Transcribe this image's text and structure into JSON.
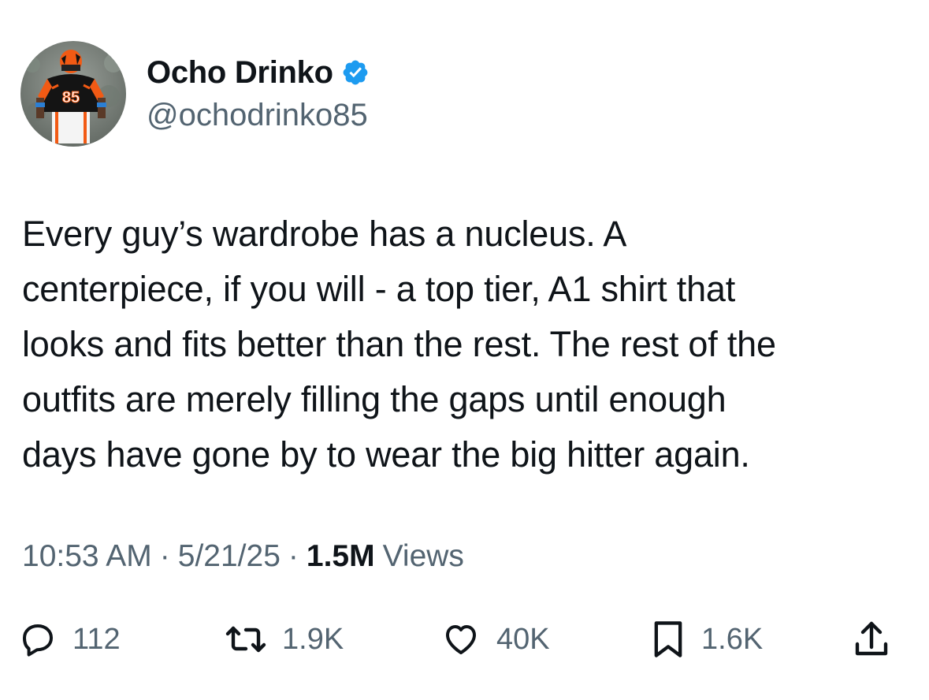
{
  "author": {
    "display_name": "Ocho Drinko",
    "handle": "@ochodrinko85",
    "verified_icon": "verified-badge-icon",
    "avatar_jersey_number": "85"
  },
  "tweet": {
    "text": "Every guy’s wardrobe has a nucleus. A\ncenterpiece, if you will - a top tier, A1 shirt that\nlooks and fits better than the rest. The rest of the\noutfits are merely filling the gaps until enough\ndays have gone by to wear the big hitter again."
  },
  "meta": {
    "time": "10:53 AM",
    "separator": "·",
    "date": "5/21/25",
    "views_count": "1.5M",
    "views_label": "Views"
  },
  "actions": {
    "reply": {
      "icon": "reply-icon",
      "count": "112"
    },
    "repost": {
      "icon": "repost-icon",
      "count": "1.9K"
    },
    "like": {
      "icon": "heart-icon",
      "count": "40K"
    },
    "bookmark": {
      "icon": "bookmark-icon",
      "count": "1.6K"
    },
    "share": {
      "icon": "share-icon"
    }
  },
  "colors": {
    "text_primary": "#0f1419",
    "text_secondary": "#536471",
    "verified_blue": "#1d9bf0",
    "background": "#ffffff"
  }
}
